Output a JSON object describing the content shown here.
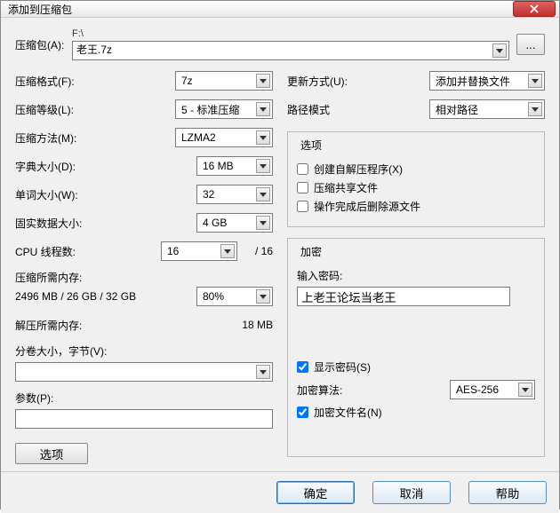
{
  "title": "添加到压缩包",
  "archive": {
    "label": "压缩包(A):",
    "path": "F:\\",
    "value": "老王.7z"
  },
  "left": {
    "format": {
      "label": "压缩格式(F):",
      "value": "7z"
    },
    "level": {
      "label": "压缩等级(L):",
      "value": "5 - 标准压缩"
    },
    "method": {
      "label": "压缩方法(M):",
      "value": "LZMA2"
    },
    "dict": {
      "label": "字典大小(D):",
      "value": "16 MB"
    },
    "word": {
      "label": "单词大小(W):",
      "value": "32"
    },
    "solid": {
      "label": "固实数据大小:",
      "value": "4 GB"
    },
    "threads": {
      "label": "CPU 线程数:",
      "value": "16",
      "max": "/ 16"
    },
    "compress_mem": {
      "label": "压缩所需内存:",
      "value": "2496 MB / 26 GB / 32 GB",
      "pct": "80%"
    },
    "decompress_mem": {
      "label": "解压所需内存:",
      "value": "18 MB"
    },
    "volume": {
      "label": "分卷大小，字节(V):",
      "value": ""
    },
    "params": {
      "label": "参数(P):",
      "value": ""
    },
    "options_btn": "选项"
  },
  "right": {
    "update": {
      "label": "更新方式(U):",
      "value": "添加并替换文件"
    },
    "pathmode": {
      "label": "路径模式",
      "value": "相对路径"
    },
    "options_legend": "选项",
    "opt_sfx": "创建自解压程序(X)",
    "opt_shared": "压缩共享文件",
    "opt_delete": "操作完成后删除源文件",
    "enc_legend": "加密",
    "enc_pw_label": "输入密码:",
    "enc_pw_value": "上老王论坛当老王",
    "enc_show": "显示密码(S)",
    "enc_method_label": "加密算法:",
    "enc_method_value": "AES-256",
    "enc_names": "加密文件名(N)"
  },
  "footer": {
    "ok": "确定",
    "cancel": "取消",
    "help": "帮助"
  }
}
